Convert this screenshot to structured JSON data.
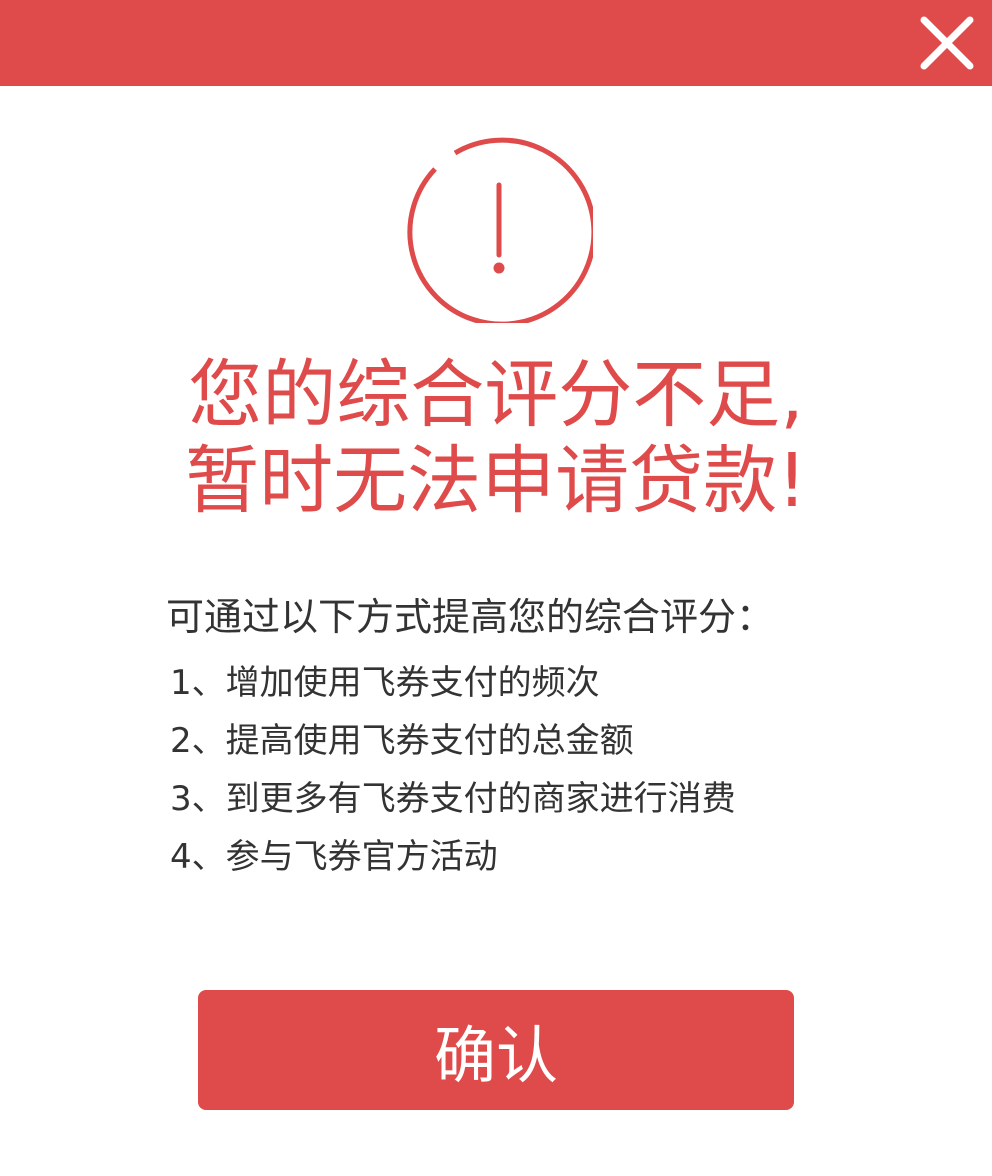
{
  "header": {
    "close_icon": "close-icon",
    "color": "#df4a4a"
  },
  "alert": {
    "icon": "exclamation-circle-icon",
    "headline_line1": "您的综合评分不足,",
    "headline_line2": "暂时无法申请贷款!"
  },
  "tips": {
    "intro": "可通过以下方式提高您的综合评分：",
    "items": [
      "1、增加使用飞券支付的频次",
      "2、提高使用飞券支付的总金额",
      "3、到更多有飞券支付的商家进行消费",
      "4、参与飞券官方活动"
    ]
  },
  "actions": {
    "confirm_label": "确认"
  },
  "colors": {
    "accent": "#df4a4a",
    "text": "#333333",
    "background": "#ffffff"
  }
}
